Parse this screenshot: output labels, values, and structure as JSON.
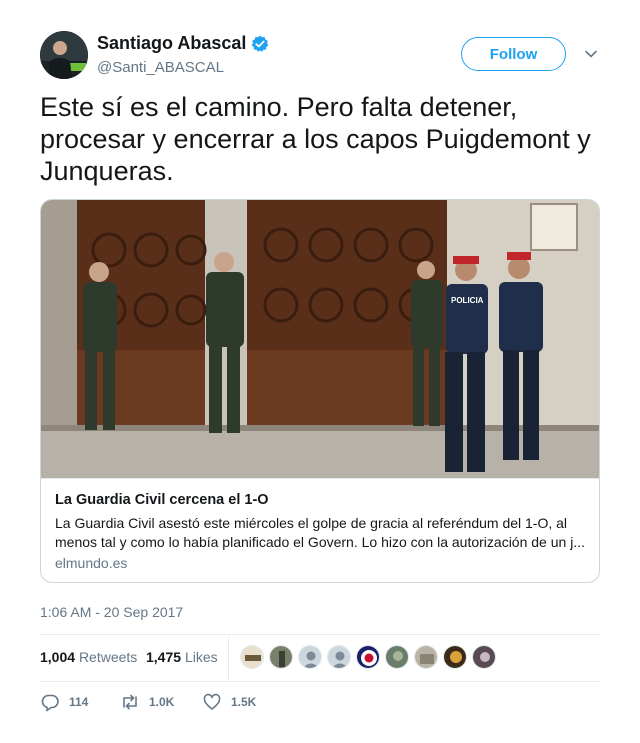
{
  "author": {
    "name": "Santiago Abascal",
    "handle": "@Santi_ABASCAL",
    "verified": true,
    "verified_icon": "verified-badge-icon"
  },
  "follow_label": "Follow",
  "tweet": {
    "text": "Este sí es el camino. Pero falta detener, procesar y encerrar a los capos Puigdemont y Junqueras."
  },
  "card": {
    "title": "La Guardia Civil cercena el 1-O",
    "description_line1": "La Guardia Civil asestó este miércoles el golpe de gracia al referéndum del 1-O, al",
    "description_line2": "menos tal y como lo había planificado el Govern. Lo hizo con la autorización de un j...",
    "domain": "elmundo.es",
    "image_badge": "POLICIA"
  },
  "timestamp": "1:06 AM - 20 Sep 2017",
  "stats": {
    "retweets_count": "1,004",
    "retweets_label": "Retweets",
    "likes_count": "1,475",
    "likes_label": "Likes"
  },
  "actions": {
    "reply_count": "114",
    "retweet_count": "1.0K",
    "like_count": "1.5K"
  },
  "colors": {
    "accent": "#1da1f2",
    "text": "#14171a",
    "muted": "#657786",
    "border": "#e6ecf0"
  }
}
